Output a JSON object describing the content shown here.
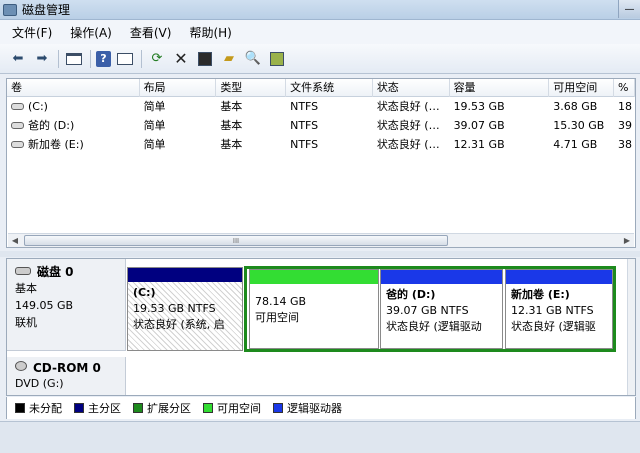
{
  "window": {
    "title": "磁盘管理",
    "minimize_glyph": "—"
  },
  "menu": [
    "文件(F)",
    "操作(A)",
    "查看(V)",
    "帮助(H)"
  ],
  "toolbar_icons": [
    "back-arrow-icon",
    "forward-arrow-icon",
    "console-tree-icon",
    "help-icon",
    "properties-icon",
    "refresh-icon",
    "delete-icon",
    "format-icon",
    "open-icon",
    "search-icon",
    "settings-icon"
  ],
  "volume_list": {
    "columns": [
      "卷",
      "布局",
      "类型",
      "文件系统",
      "状态",
      "容量",
      "可用空间",
      "%"
    ],
    "rows": [
      [
        "(C:)",
        "简单",
        "基本",
        "NTFS",
        "状态良好 (…",
        "19.53 GB",
        "3.68 GB",
        "18"
      ],
      [
        "爸的 (D:)",
        "简单",
        "基本",
        "NTFS",
        "状态良好 (…",
        "39.07 GB",
        "15.30 GB",
        "39"
      ],
      [
        "新加卷 (E:)",
        "简单",
        "基本",
        "NTFS",
        "状态良好 (…",
        "12.31 GB",
        "4.71 GB",
        "38"
      ]
    ],
    "scroll_thumb_glyph": "III"
  },
  "disks": [
    {
      "name": "磁盘 0",
      "type": "基本",
      "size": "149.05 GB",
      "status": "联机",
      "partitions": [
        {
          "title": "(C:)",
          "size": "19.53 GB NTFS",
          "status": "状态良好 (系统, 启"
        },
        {
          "title": "",
          "size": "78.14 GB",
          "status": "可用空间"
        },
        {
          "title": "爸的  (D:)",
          "size": "39.07 GB NTFS",
          "status": "状态良好 (逻辑驱动"
        },
        {
          "title": "新加卷  (E:)",
          "size": "12.31 GB NTFS",
          "status": "状态良好 (逻辑驱"
        }
      ]
    },
    {
      "name": "CD-ROM 0",
      "type": "DVD (G:)"
    }
  ],
  "legend": [
    {
      "label": "未分配",
      "color": "#000000"
    },
    {
      "label": "主分区",
      "color": "#000080"
    },
    {
      "label": "扩展分区",
      "color": "#1d8a1d"
    },
    {
      "label": "可用空间",
      "color": "#33dd33"
    },
    {
      "label": "逻辑驱动器",
      "color": "#1a38e8"
    }
  ]
}
